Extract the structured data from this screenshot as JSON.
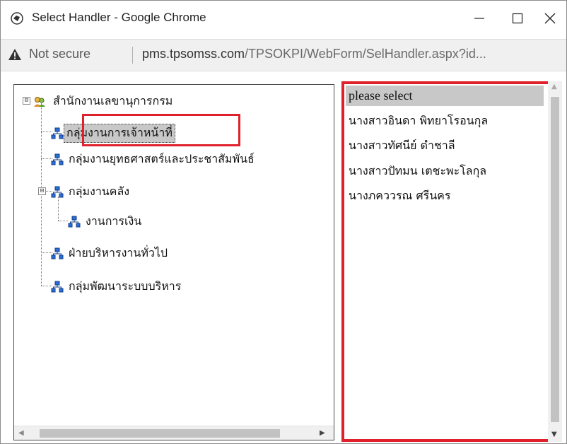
{
  "window": {
    "title": "Select Handler - Google Chrome",
    "controls": {
      "minimize": "—",
      "maximize": "☐",
      "close": "✕"
    }
  },
  "address_bar": {
    "security_label": "Not secure",
    "url_domain": "pms.tpsomss.com",
    "url_path": "/TPSOKPI/WebForm/SelHandler.aspx?id..."
  },
  "tree": {
    "root": {
      "label": "สำนักงานเลขานุการกรม",
      "expander": "⊟"
    },
    "items": [
      {
        "label": "กลุ่มงานการเจ้าหน้าที่",
        "selected": true
      },
      {
        "label": "กลุ่มงานยุทธศาสตร์และประชาสัมพันธ์"
      },
      {
        "label": "กลุ่มงานคลัง",
        "expander": "⊟"
      },
      {
        "label": "งานการเงิน"
      },
      {
        "label": "ฝ่ายบริหารงานทั่วไป"
      },
      {
        "label": "กลุ่มพัฒนาระบบบริหาร"
      }
    ]
  },
  "handler_list": {
    "items": [
      "please select",
      "นางสาวอินดา พิทยาโรอนกุล",
      "นางสาวทัศนีย์ ดำชาลี",
      "นางสาวปัทมน เตชะพะโลกุล",
      "นางภคววรณ ศรีนคร"
    ]
  },
  "colors": {
    "highlight": "#e0202a",
    "selection": "#c8c8c8",
    "org_icon": "#2a6ed8"
  },
  "icons": [
    "globe-icon",
    "warning-icon",
    "org-icon",
    "people-icon"
  ]
}
